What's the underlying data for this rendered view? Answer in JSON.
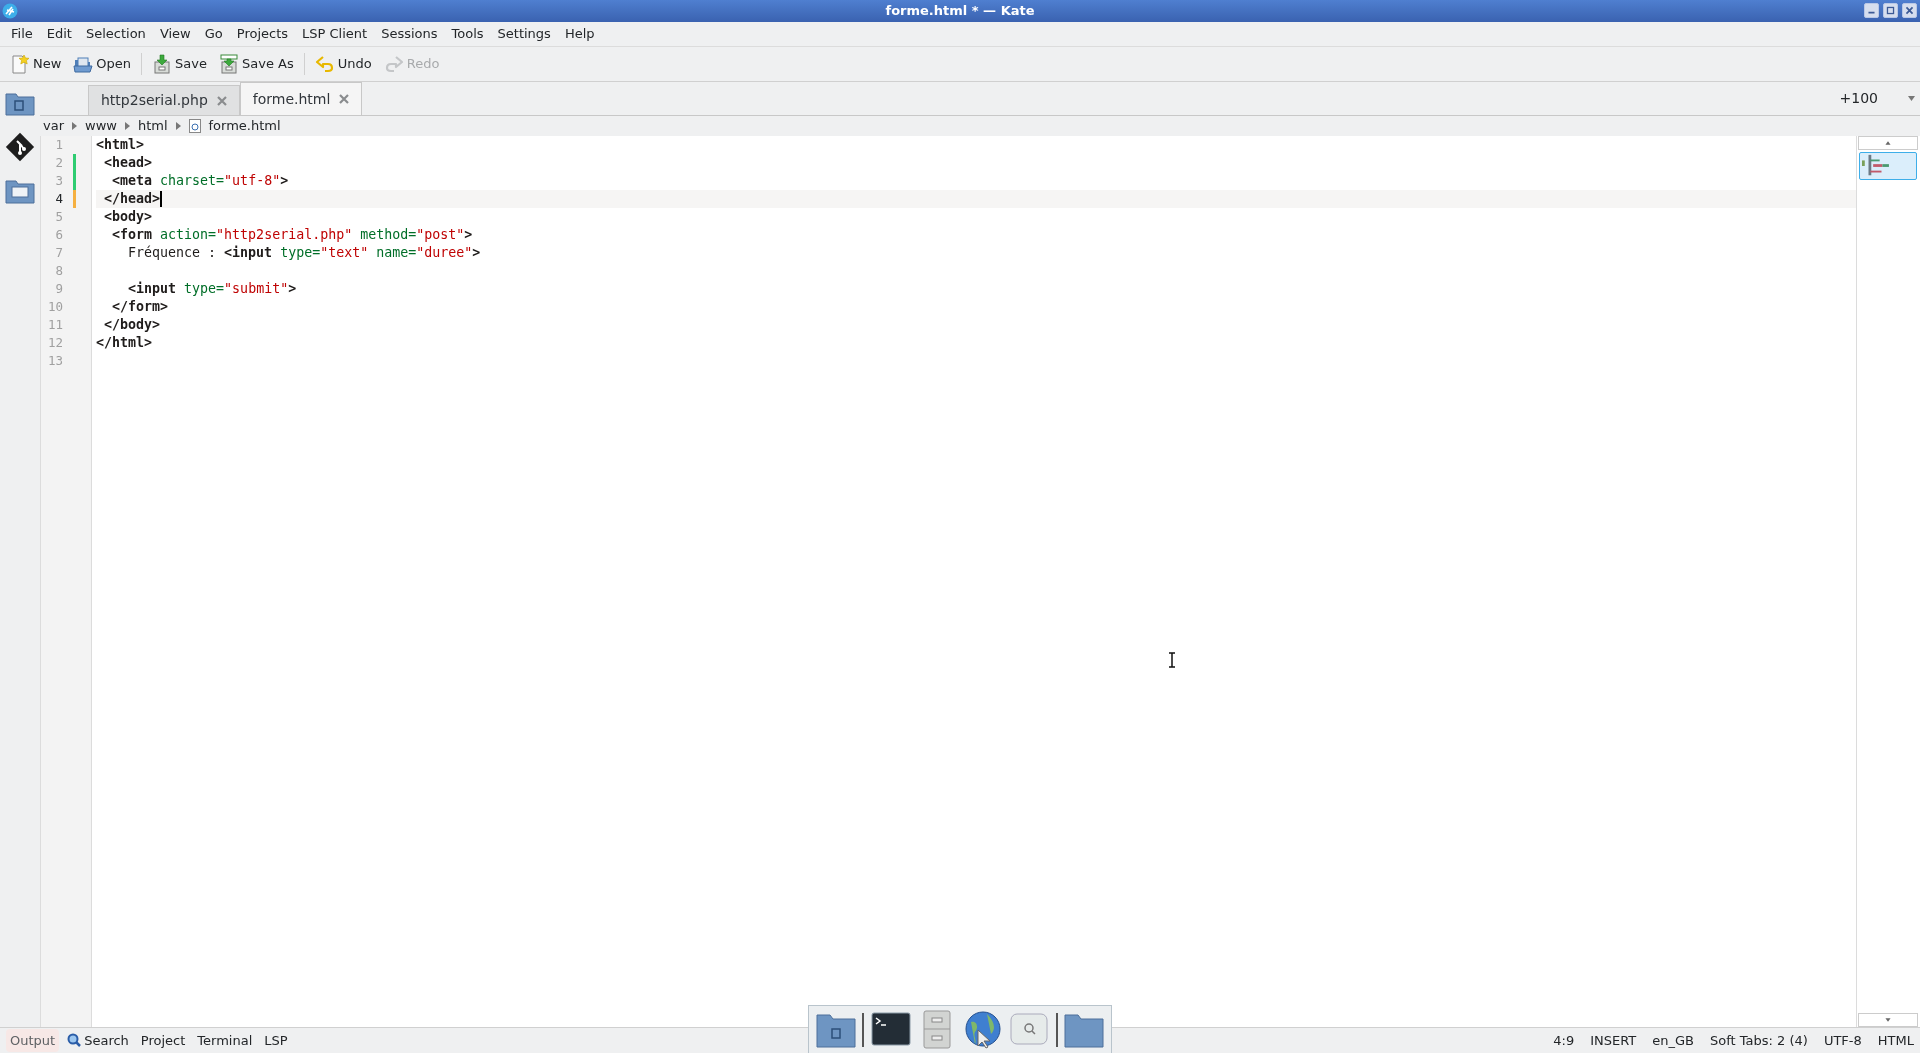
{
  "window": {
    "title": "forme.html * — Kate"
  },
  "menu": [
    "File",
    "Edit",
    "Selection",
    "View",
    "Go",
    "Projects",
    "LSP Client",
    "Sessions",
    "Tools",
    "Settings",
    "Help"
  ],
  "toolbar": [
    {
      "kind": "new",
      "label": "New",
      "disabled": false
    },
    {
      "kind": "open",
      "label": "Open",
      "disabled": false
    },
    {
      "kind": "save",
      "label": "Save",
      "disabled": false
    },
    {
      "kind": "saveas",
      "label": "Save As",
      "disabled": false
    },
    {
      "kind": "undo",
      "label": "Undo",
      "disabled": false
    },
    {
      "kind": "redo",
      "label": "Redo",
      "disabled": true
    }
  ],
  "tabs": [
    {
      "label": "http2serial.php",
      "selected": false
    },
    {
      "label": "forme.html",
      "selected": true
    }
  ],
  "tab_counter": "+100",
  "breadcrumb": [
    "var",
    "www",
    "html",
    "forme.html"
  ],
  "editor": {
    "lines": [
      {
        "number": "1",
        "added": false,
        "modified": false,
        "current": false,
        "tokens": [
          {
            "kind": "tag",
            "text": "<html>"
          }
        ]
      },
      {
        "number": "2",
        "added": true,
        "modified": false,
        "current": false,
        "tokens": [
          {
            "kind": "tag",
            "text": " <head>"
          }
        ]
      },
      {
        "number": "3",
        "added": true,
        "modified": false,
        "current": false,
        "tokens": [
          {
            "kind": "tag",
            "text": "  <meta"
          },
          {
            "kind": "attr",
            "text": " charset="
          },
          {
            "kind": "str",
            "text": "\"utf-8\""
          },
          {
            "kind": "tag",
            "text": ">"
          }
        ]
      },
      {
        "number": "4",
        "added": false,
        "modified": true,
        "current": true,
        "tokens": [
          {
            "kind": "tag",
            "text": " </head>"
          }
        ]
      },
      {
        "number": "5",
        "added": false,
        "modified": false,
        "current": false,
        "tokens": [
          {
            "kind": "tag",
            "text": " <body>"
          }
        ]
      },
      {
        "number": "6",
        "added": false,
        "modified": false,
        "current": false,
        "tokens": [
          {
            "kind": "tag",
            "text": "  <form"
          },
          {
            "kind": "attr",
            "text": " action="
          },
          {
            "kind": "str",
            "text": "\"http2serial.php\""
          },
          {
            "kind": "attr",
            "text": " method="
          },
          {
            "kind": "str",
            "text": "\"post\""
          },
          {
            "kind": "tag",
            "text": ">"
          }
        ]
      },
      {
        "number": "7",
        "added": false,
        "modified": false,
        "current": false,
        "tokens": [
          {
            "kind": "text",
            "text": "    Fréquence : "
          },
          {
            "kind": "tag",
            "text": "<input"
          },
          {
            "kind": "attr",
            "text": " type="
          },
          {
            "kind": "str",
            "text": "\"text\""
          },
          {
            "kind": "attr",
            "text": " name="
          },
          {
            "kind": "str",
            "text": "\"duree\""
          },
          {
            "kind": "tag",
            "text": ">"
          }
        ]
      },
      {
        "number": "8",
        "added": false,
        "modified": false,
        "current": false
      },
      {
        "number": "9",
        "added": false,
        "modified": false,
        "current": false,
        "tokens": [
          {
            "kind": "tag",
            "text": "    <input"
          },
          {
            "kind": "attr",
            "text": " type="
          },
          {
            "kind": "str",
            "text": "\"submit\""
          },
          {
            "kind": "tag",
            "text": ">"
          }
        ]
      },
      {
        "number": "10",
        "added": false,
        "modified": false,
        "current": false,
        "tokens": [
          {
            "kind": "tag",
            "text": "  </form>"
          }
        ]
      },
      {
        "number": "11",
        "added": false,
        "modified": false,
        "current": false,
        "tokens": [
          {
            "kind": "tag",
            "text": " </body>"
          }
        ]
      },
      {
        "number": "12",
        "added": false,
        "modified": false,
        "current": false,
        "tokens": [
          {
            "kind": "tag",
            "text": "</html>"
          }
        ]
      },
      {
        "number": "13",
        "added": false,
        "modified": false,
        "current": false
      }
    ]
  },
  "bottom_tabs": [
    {
      "label": "Output",
      "selected": true,
      "kind": "plain"
    },
    {
      "label": "Search",
      "selected": false,
      "kind": "search"
    },
    {
      "label": "Project",
      "selected": false,
      "kind": "plain"
    },
    {
      "label": "Terminal",
      "selected": false,
      "kind": "plain"
    },
    {
      "label": "LSP",
      "selected": false,
      "kind": "plain"
    }
  ],
  "status": [
    "4:9",
    "INSERT",
    "en_GB",
    "Soft Tabs: 2 (4)",
    "UTF-8",
    "HTML"
  ],
  "dock": [
    {
      "kind": "documents"
    },
    {
      "kind": "terminal"
    },
    {
      "kind": "cabinet"
    },
    {
      "kind": "browser"
    },
    {
      "kind": "search"
    },
    {
      "kind": "folder"
    }
  ]
}
